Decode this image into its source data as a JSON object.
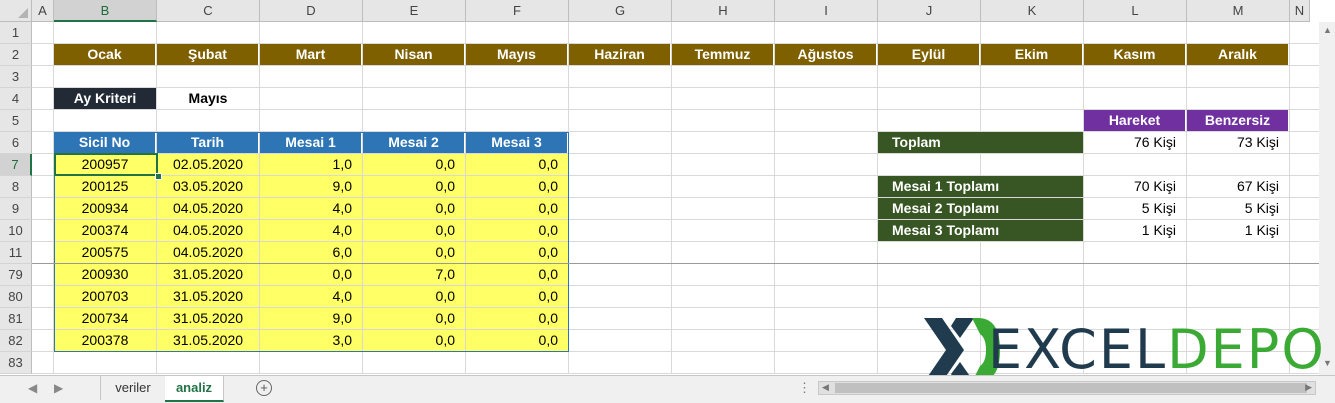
{
  "columns": [
    "A",
    "B",
    "C",
    "D",
    "E",
    "F",
    "G",
    "H",
    "I",
    "J",
    "K",
    "L",
    "M",
    "N"
  ],
  "rows": [
    "1",
    "2",
    "3",
    "4",
    "5",
    "6",
    "7",
    "8",
    "9",
    "10",
    "11",
    "79",
    "80",
    "81",
    "82",
    "83"
  ],
  "months": [
    "Ocak",
    "Şubat",
    "Mart",
    "Nisan",
    "Mayıs",
    "Haziran",
    "Temmuz",
    "Ağustos",
    "Eylül",
    "Ekim",
    "Kasım",
    "Aralık"
  ],
  "criteria": {
    "label": "Ay Kriteri",
    "value": "Mayıs"
  },
  "table": {
    "headers": [
      "Sicil No",
      "Tarih",
      "Mesai 1",
      "Mesai 2",
      "Mesai 3"
    ],
    "rows": [
      [
        "200957",
        "02.05.2020",
        "1,0",
        "0,0",
        "0,0"
      ],
      [
        "200125",
        "03.05.2020",
        "9,0",
        "0,0",
        "0,0"
      ],
      [
        "200934",
        "04.05.2020",
        "4,0",
        "0,0",
        "0,0"
      ],
      [
        "200374",
        "04.05.2020",
        "4,0",
        "0,0",
        "0,0"
      ],
      [
        "200575",
        "04.05.2020",
        "6,0",
        "0,0",
        "0,0"
      ],
      [
        "200930",
        "31.05.2020",
        "0,0",
        "7,0",
        "0,0"
      ],
      [
        "200703",
        "31.05.2020",
        "4,0",
        "0,0",
        "0,0"
      ],
      [
        "200734",
        "31.05.2020",
        "9,0",
        "0,0",
        "0,0"
      ],
      [
        "200378",
        "31.05.2020",
        "3,0",
        "0,0",
        "0,0"
      ]
    ]
  },
  "summary": {
    "headers": [
      "Hareket",
      "Benzersiz"
    ],
    "toplam": {
      "label": "Toplam",
      "hareket": "76 Kişi",
      "benzersiz": "73 Kişi"
    },
    "rows": [
      {
        "label": "Mesai 1 Toplamı",
        "hareket": "70 Kişi",
        "benzersiz": "67 Kişi"
      },
      {
        "label": "Mesai 2 Toplamı",
        "hareket": "5 Kişi",
        "benzersiz": "5 Kişi"
      },
      {
        "label": "Mesai 3 Toplamı",
        "hareket": "1 Kişi",
        "benzersiz": "1 Kişi"
      }
    ]
  },
  "sheets": [
    "veriler",
    "analiz"
  ],
  "active_sheet": "analiz",
  "logo": {
    "part1": "EXCEL",
    "part2": "DEPO"
  },
  "colors": {
    "month_header": "#7f6000",
    "table_header": "#2e75b6",
    "data_fill": "#ffff66",
    "summary_label": "#375623",
    "summary_header": "#7030a0",
    "criteria_label": "#222b35",
    "logo_x": "#1f3b4d",
    "logo_green": "#3aaa35"
  }
}
